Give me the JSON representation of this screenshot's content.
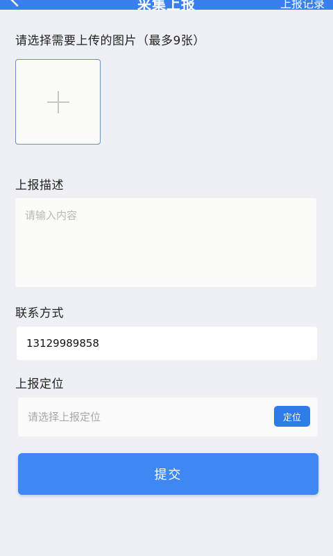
{
  "header": {
    "title": "采集上报",
    "records_label": "上报记录",
    "background_color": "#3a7ff0",
    "back_icon": "chevron-left-icon"
  },
  "upload": {
    "label": "请选择需要上传的图片（最多9张）",
    "add_icon": "plus-icon"
  },
  "description": {
    "label": "上报描述",
    "placeholder": "请输入内容",
    "value": ""
  },
  "contact": {
    "label": "联系方式",
    "value": "13129989858"
  },
  "location": {
    "label": "上报定位",
    "placeholder": "请选择上报定位",
    "locate_label": "定位"
  },
  "submit": {
    "label": "提交",
    "color": "#3d88f2"
  }
}
